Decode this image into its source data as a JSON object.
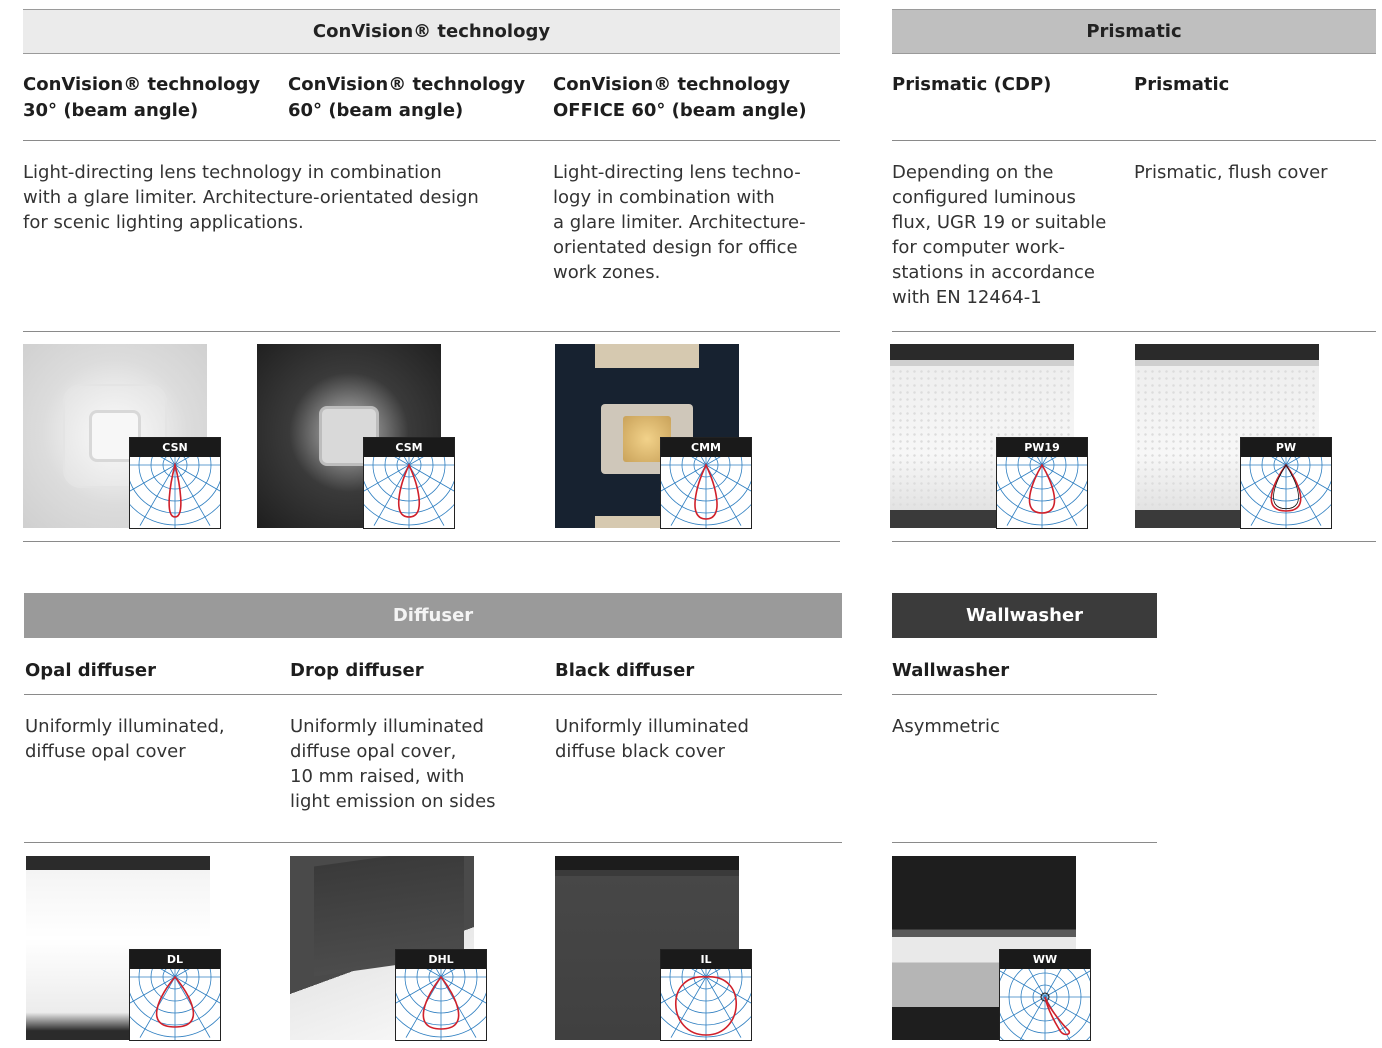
{
  "convision": {
    "title": "ConVision® technology",
    "columns": [
      {
        "title": "ConVision® technology\n30° (beam angle)",
        "description": "Light-directing lens technology in combination\nwith a glare limiter. Architecture-orientated design\nfor scenic lighting applications.",
        "code": "CSN"
      },
      {
        "title": "ConVision® technology\n60° (beam angle)",
        "description": "",
        "code": "CSM"
      },
      {
        "title": "ConVision® technology\nOFFICE 60° (beam angle)",
        "description": "Light-directing lens techno-\nlogy in combination with\na glare limiter. Architecture-\norientated design for office\nwork zones.",
        "code": "CMM"
      }
    ]
  },
  "prismatic": {
    "title": "Prismatic",
    "columns": [
      {
        "title": "Prismatic (CDP)",
        "description": "Depending on the\nconfigured luminous\nflux, UGR 19 or suitable\nfor computer work-\nstations in accordance\nwith EN 12464-1",
        "code": "PW19"
      },
      {
        "title": "Prismatic",
        "description": "Prismatic, flush cover",
        "code": "PW"
      }
    ]
  },
  "diffuser": {
    "title": "Diffuser",
    "columns": [
      {
        "title": "Opal diffuser",
        "description": "Uniformly illuminated,\ndiffuse opal cover",
        "code": "DL"
      },
      {
        "title": "Drop diffuser",
        "description": "Uniformly illuminated\ndiffuse opal cover,\n10 mm raised, with\nlight emission on sides",
        "code": "DHL"
      },
      {
        "title": "Black diffuser",
        "description": "Uniformly illuminated\ndiffuse black cover",
        "code": "IL"
      }
    ]
  },
  "wallwasher": {
    "title": "Wallwasher",
    "columns": [
      {
        "title": "Wallwasher",
        "description": "Asymmetric",
        "code": "WW"
      }
    ]
  },
  "colors": {
    "diagram_grid": "#2f7fc1",
    "diagram_curve": "#d0202a",
    "rule": "#8a8a8a"
  }
}
